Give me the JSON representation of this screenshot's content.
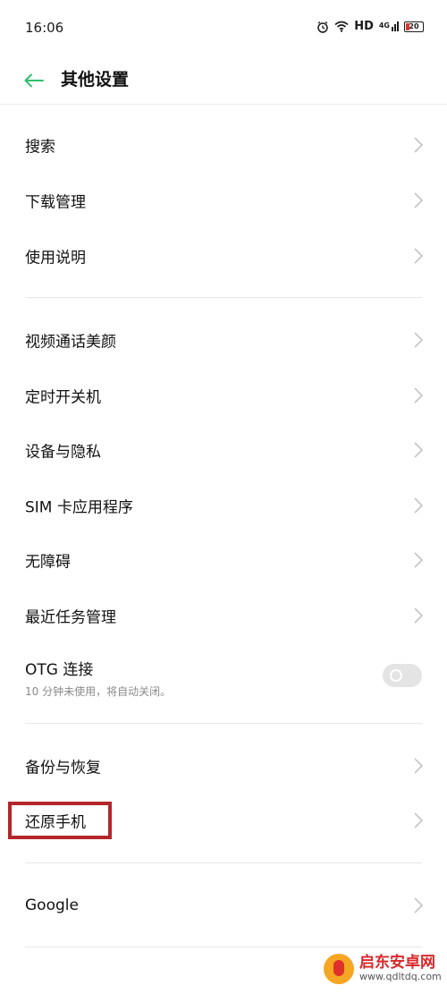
{
  "status_bar": {
    "time": "16:06",
    "network_label": "HD",
    "signal_label": "4G",
    "battery_level": "20"
  },
  "header": {
    "title": "其他设置"
  },
  "groups": {
    "group1": [
      {
        "label": "搜索"
      },
      {
        "label": "下载管理"
      },
      {
        "label": "使用说明"
      }
    ],
    "group2": [
      {
        "label": "视频通话美颜"
      },
      {
        "label": "定时开关机"
      },
      {
        "label": "设备与隐私"
      },
      {
        "label": "SIM 卡应用程序"
      },
      {
        "label": "无障碍"
      },
      {
        "label": "最近任务管理"
      }
    ],
    "otg": {
      "label": "OTG 连接",
      "subtitle": "10 分钟未使用，将自动关闭。",
      "enabled": false
    },
    "group3": [
      {
        "label": "备份与恢复"
      },
      {
        "label": "还原手机"
      }
    ],
    "group4": [
      {
        "label": "Google"
      }
    ]
  },
  "colors": {
    "accent": "#2fbf71",
    "highlight": "#b3262a"
  },
  "watermark": {
    "cn": "启东安卓网",
    "url": "www.qdltdq.com"
  }
}
